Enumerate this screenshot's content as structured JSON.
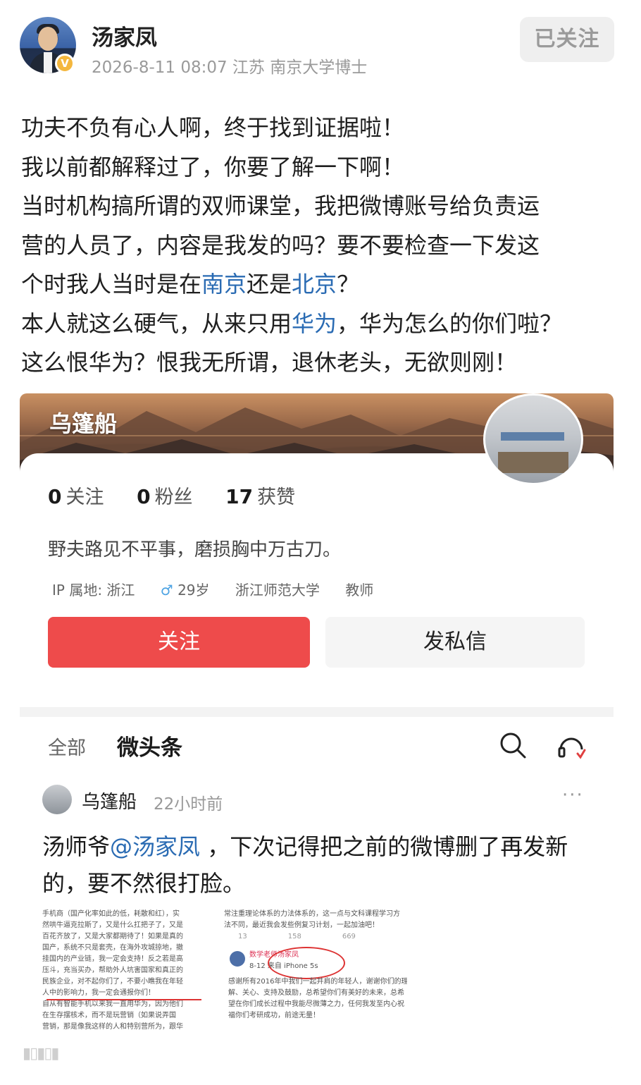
{
  "header": {
    "name": "汤家凤",
    "meta": "2026-8-11 08:07 江苏 南京大学博士",
    "verified_badge": "V",
    "follow_label": "已关注"
  },
  "post": {
    "line1": "功夫不负有心人啊，终于找到证据啦！",
    "line2": "我以前都解释过了，你要了解一下啊！",
    "line3": "当时机构搞所谓的双师课堂，我把微博账号给负责运",
    "line4": "营的人员了，内容是我发的吗？要不要检查一下发这",
    "line5_a": "个时我人当时是在",
    "line5_link1": "南京",
    "line5_b": "还是",
    "line5_link2": "北京",
    "line5_c": "？",
    "line6_a": "本人就这么硬气，从来只用",
    "line6_link": "华为",
    "line6_b": "，华为怎么的你们啦？",
    "line7": "这么恨华为？恨我无所谓，退休老头，无欲则刚！",
    "link_color": "#2a6bb3"
  },
  "screenshot": {
    "banner_title": "乌篷船",
    "stats": {
      "following_count": "0",
      "following_label": "关注",
      "fans_count": "0",
      "fans_label": "粉丝",
      "likes_count": "17",
      "likes_label": "获赞"
    },
    "bio": "野夫路见不平事，磨损胸中万古刀。",
    "tags": {
      "ip": "IP 属地: 浙江",
      "gender_icon": "♂",
      "age": "29岁",
      "school": "浙江师范大学",
      "job": "教师"
    },
    "follow_label": "关注",
    "message_label": "发私信",
    "tabs": {
      "all": "全部",
      "weitoutiao": "微头条"
    },
    "feed": {
      "author": "乌篷船",
      "time": "22小时前",
      "more": "···",
      "text_a": "汤师爷",
      "mention": "@汤家凤",
      "text_b": " ，下次记得把之前的微博删了再发新的，要不然很打脸。"
    },
    "embedded_left": [
      "手机商（国产化率如此的低，耗散和红），实",
      "然哄牛逼克拉斯了，又是什么扛把子了，又是",
      "百花齐放了，又是大家都期待了！如果是真的",
      "国产，系统不只是套壳，在海外攻城掠地，撤",
      "挂国内的产业链，我一定会支持！反之若是高",
      "压斗，充当买办，帮助外人坑害国家和真正的",
      "民族企业，对不起你们了，不要小瞧我在年轻",
      "人中的影响力，我一定会通报你们！",
      "自从有智能手机以来我一直用华为，因为他们",
      "在生存摆核术，而不是玩营销（如果说弄国",
      "营销，那是像我这样的人和特别营所为，跟华"
    ],
    "embedded_right": {
      "top1": "常注重理论体系的力法体系的，这一点与文科课程学习方",
      "top2": "法不同，最近我会发些例复习计划，一起加油吧！",
      "stat1": "13",
      "stat2": "158",
      "stat3": "669",
      "author": "数学老师汤家凤",
      "source": "8-12 来自 iPhone 5s",
      "body1": "感谢所有2016年中我们一起并肩的年轻人，谢谢你们的理",
      "body2": "解、关心、支持及鼓励，总希望你们有美好的未来，总希",
      "body3": "望在你们成长过程中我能尽微薄之力，任何我发至内心祝",
      "body4": "福你们考研成功，前途无量！"
    }
  }
}
